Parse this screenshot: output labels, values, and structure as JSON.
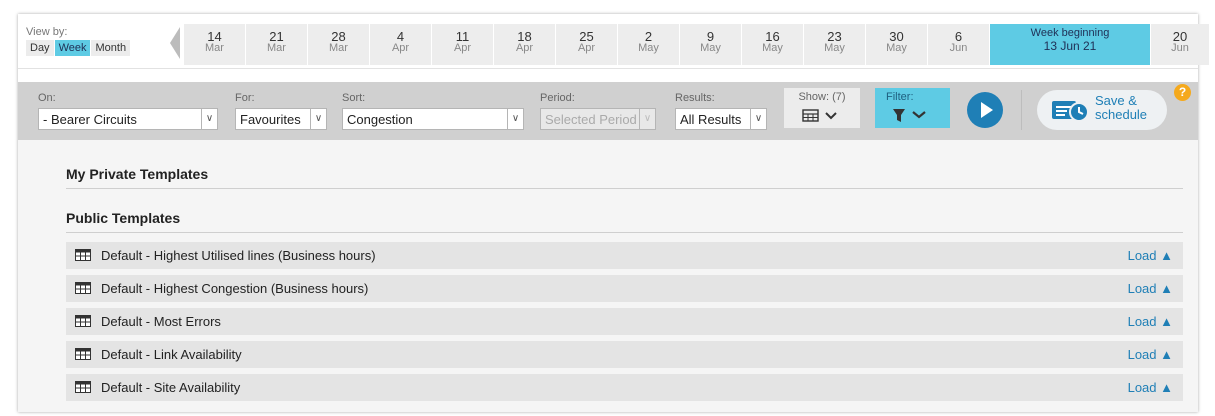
{
  "view_by": {
    "label": "View by:",
    "options": [
      "Day",
      "Week",
      "Month"
    ],
    "selected": "Week"
  },
  "weeks": [
    {
      "day": "14",
      "month": "Mar"
    },
    {
      "day": "21",
      "month": "Mar"
    },
    {
      "day": "28",
      "month": "Mar"
    },
    {
      "day": "4",
      "month": "Apr"
    },
    {
      "day": "11",
      "month": "Apr"
    },
    {
      "day": "18",
      "month": "Apr"
    },
    {
      "day": "25",
      "month": "Apr"
    },
    {
      "day": "2",
      "month": "May"
    },
    {
      "day": "9",
      "month": "May"
    },
    {
      "day": "16",
      "month": "May"
    },
    {
      "day": "23",
      "month": "May"
    },
    {
      "day": "30",
      "month": "May"
    },
    {
      "day": "6",
      "month": "Jun"
    }
  ],
  "current_week": {
    "label": "Week beginning",
    "date": "13 Jun 21"
  },
  "next_week": {
    "day": "20",
    "month": "Jun"
  },
  "toolbar": {
    "on": {
      "label": "On:",
      "value": "- Bearer Circuits"
    },
    "for": {
      "label": "For:",
      "value": "Favourites"
    },
    "sort": {
      "label": "Sort:",
      "value": "Congestion"
    },
    "period": {
      "label": "Period:",
      "value": "Selected Period"
    },
    "results": {
      "label": "Results:",
      "value": "All Results"
    },
    "show": {
      "label": "Show: (7)"
    },
    "filter": {
      "label": "Filter:"
    },
    "save": {
      "line1": "Save &",
      "line2": "schedule"
    },
    "help": "?"
  },
  "sections": {
    "private_title": "My Private Templates",
    "public_title": "Public Templates"
  },
  "templates": [
    {
      "name": "Default - Highest Utilised lines (Business hours)",
      "action": "Load ▲"
    },
    {
      "name": "Default - Highest Congestion (Business hours)",
      "action": "Load ▲"
    },
    {
      "name": "Default - Most Errors",
      "action": "Load ▲"
    },
    {
      "name": "Default - Link Availability",
      "action": "Load ▲"
    },
    {
      "name": "Default - Site Availability",
      "action": "Load ▲"
    }
  ],
  "colors": {
    "accent": "#5ecbe4",
    "primary_blue": "#1f7fb6",
    "help_orange": "#f5a91c"
  }
}
